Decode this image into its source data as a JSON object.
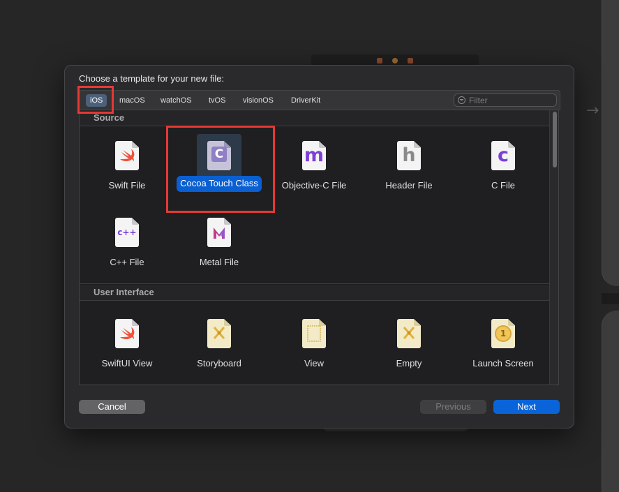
{
  "dialog": {
    "title": "Choose a template for your new file:",
    "platform_tabs": [
      "iOS",
      "macOS",
      "watchOS",
      "tvOS",
      "visionOS",
      "DriverKit"
    ],
    "selected_tab": "iOS",
    "filter_placeholder": "Filter",
    "sections": [
      {
        "title": "Source",
        "templates": [
          {
            "label": "Swift File",
            "icon": "swift-icon"
          },
          {
            "label": "Cocoa Touch Class",
            "icon": "c-class-icon",
            "selected": true
          },
          {
            "label": "Objective-C File",
            "icon": "m-icon",
            "glyph": "m"
          },
          {
            "label": "Header File",
            "icon": "h-icon",
            "glyph": "h"
          },
          {
            "label": "C File",
            "icon": "c-icon",
            "glyph": "c"
          },
          {
            "label": "C++ File",
            "icon": "cpp-icon",
            "glyph": "c++"
          },
          {
            "label": "Metal File",
            "icon": "metal-icon"
          }
        ]
      },
      {
        "title": "User Interface",
        "templates": [
          {
            "label": "SwiftUI View",
            "icon": "swift-icon"
          },
          {
            "label": "Storyboard",
            "icon": "storyboard-icon"
          },
          {
            "label": "View",
            "icon": "view-icon"
          },
          {
            "label": "Empty",
            "icon": "empty-icon"
          },
          {
            "label": "Launch Screen",
            "icon": "launch-screen-icon",
            "glyph": "1"
          }
        ]
      }
    ],
    "buttons": {
      "cancel": "Cancel",
      "previous": "Previous",
      "next": "Next"
    }
  },
  "colors": {
    "accent": "#0a64d9",
    "selected_tab": "#4c607a",
    "highlight_box": "#e53935",
    "swift": "#f05138",
    "purple_glyph": "#7c3fd6"
  }
}
